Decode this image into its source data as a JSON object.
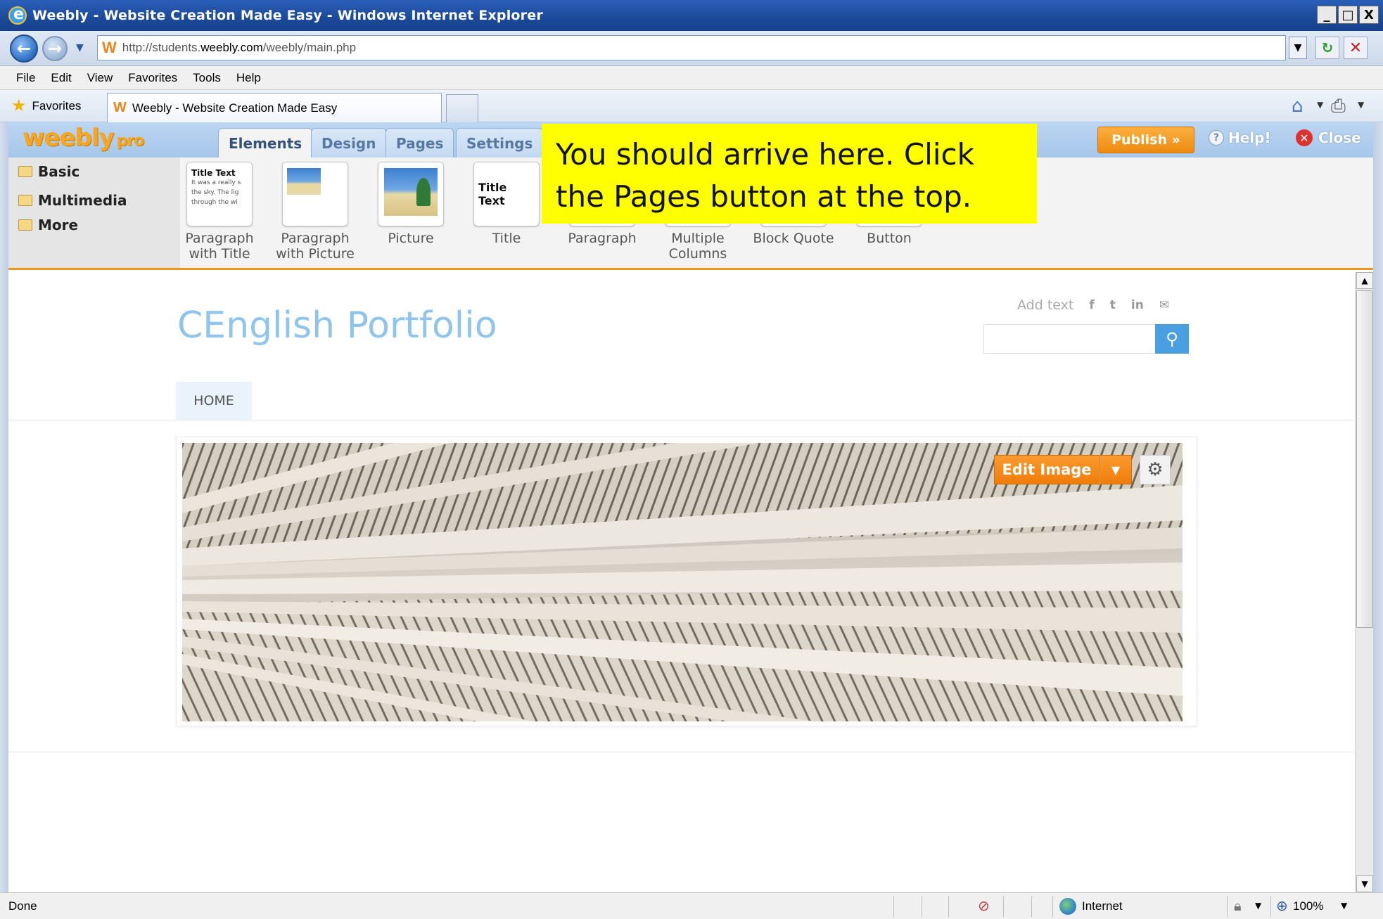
{
  "window": {
    "title": "Weebly - Website Creation Made Easy - Windows Internet Explorer",
    "minimize": "_",
    "maximize": "□",
    "close": "X"
  },
  "address": {
    "url_prefix": "http://students.",
    "url_domain": "weebly.com",
    "url_path": "/weebly/main.php"
  },
  "menu": [
    "File",
    "Edit",
    "View",
    "Favorites",
    "Tools",
    "Help"
  ],
  "favorites": {
    "label": "Favorites",
    "tab_title": "Weebly - Website Creation Made Easy"
  },
  "weebly": {
    "logo": "weebly",
    "logo_suffix": "pro",
    "tabs": {
      "elements": "Elements",
      "design": "Design",
      "pages": "Pages",
      "settings": "Settings"
    },
    "publish": "Publish »",
    "help": "Help!",
    "close": "Close",
    "categories": [
      "Basic",
      "Multimedia",
      "More"
    ],
    "elements": [
      {
        "line1": "Paragraph",
        "line2": "with Title"
      },
      {
        "line1": "Paragraph",
        "line2": "with Picture"
      },
      {
        "line1": "Picture",
        "line2": ""
      },
      {
        "line1": "Title",
        "line2": ""
      },
      {
        "line1": "Paragraph",
        "line2": ""
      },
      {
        "line1": "Multiple",
        "line2": "Columns"
      },
      {
        "line1": "Block Quote",
        "line2": ""
      },
      {
        "line1": "Button",
        "line2": ""
      }
    ],
    "thumb_title_text": "Title Text",
    "thumb_paragraph_text": "It was a really s the sky. The lig through the wi"
  },
  "callout": {
    "text": "You should arrive here. Click the Pages button at the top."
  },
  "site": {
    "title": "CEnglish Portfolio",
    "add_text": "Add text",
    "social": [
      "f",
      "t",
      "in",
      "✉"
    ],
    "nav_home": "HOME",
    "edit_image": "Edit Image"
  },
  "status": {
    "text": "Done",
    "zone": "Internet",
    "zoom": "100%"
  },
  "colors": {
    "accent_orange": "#ef7d0c",
    "site_title_blue": "#8fc4ec",
    "callout_yellow": "#ffff00"
  }
}
